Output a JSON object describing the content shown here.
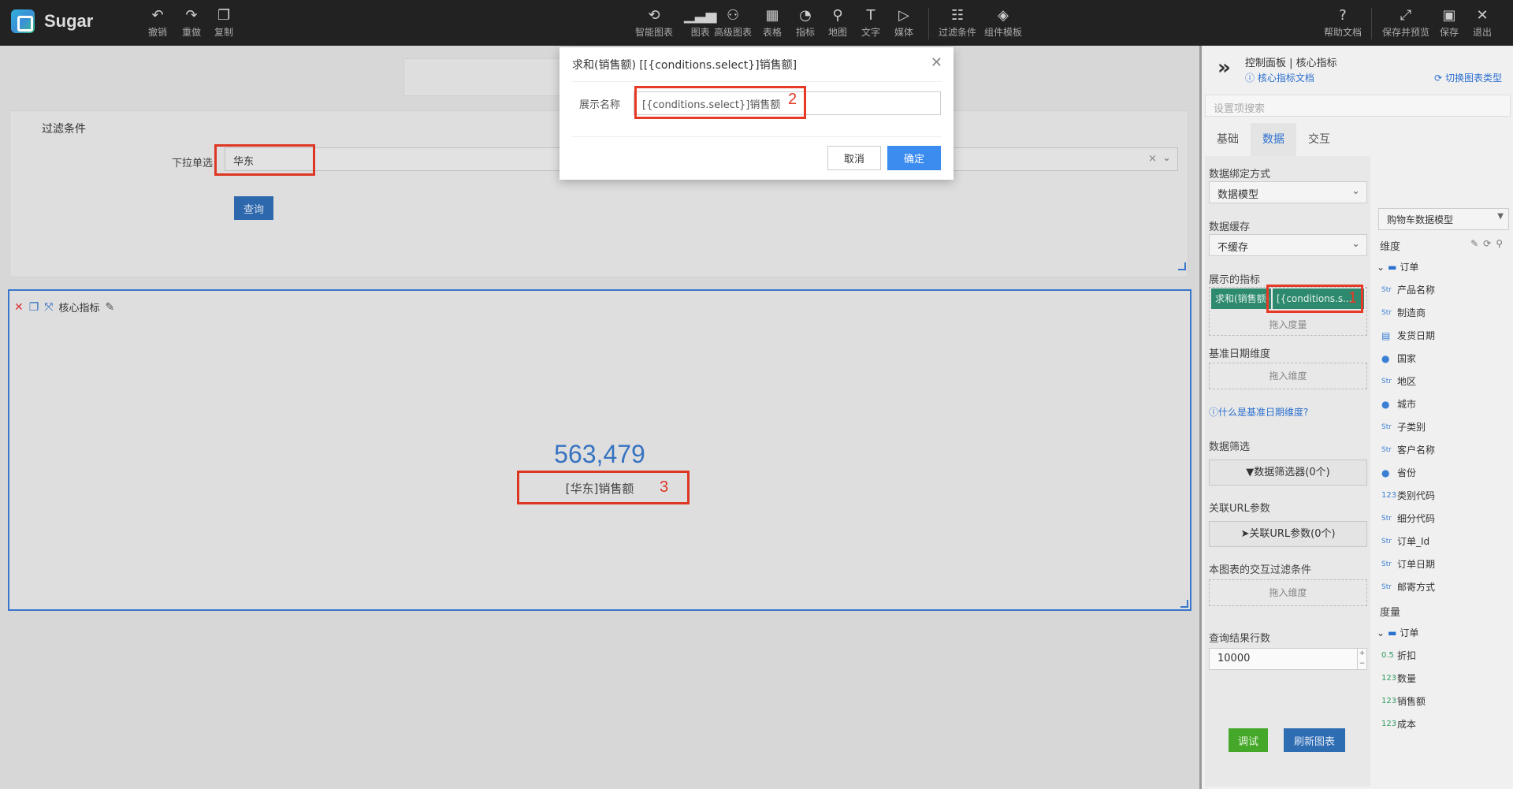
{
  "app": {
    "name": "Sugar"
  },
  "toolbar": {
    "left": [
      {
        "icon": "undo-icon",
        "label": "撤销"
      },
      {
        "icon": "redo-icon",
        "label": "重做"
      },
      {
        "icon": "copy-icon",
        "label": "复制"
      }
    ],
    "center": [
      {
        "icon": "smart-chart-icon",
        "label": "智能图表"
      },
      {
        "icon": "chart-icon",
        "label": "图表"
      },
      {
        "icon": "advanced-chart-icon",
        "label": "高级图表"
      },
      {
        "icon": "table-icon",
        "label": "表格"
      },
      {
        "icon": "gauge-icon",
        "label": "指标"
      },
      {
        "icon": "map-icon",
        "label": "地图"
      },
      {
        "icon": "text-icon",
        "label": "文字"
      },
      {
        "icon": "media-icon",
        "label": "媒体"
      },
      {
        "icon": "filter-condition-icon",
        "label": "过滤条件"
      },
      {
        "icon": "component-template-icon",
        "label": "组件模板"
      }
    ],
    "right": [
      {
        "icon": "help-icon",
        "label": "帮助文档"
      },
      {
        "icon": "save-preview-icon",
        "label": "保存并预览"
      },
      {
        "icon": "save-icon",
        "label": "保存"
      },
      {
        "icon": "exit-icon",
        "label": "退出"
      }
    ]
  },
  "filter": {
    "title": "过滤条件",
    "label": "下拉单选",
    "value": "华东",
    "query_label": "查询"
  },
  "chart": {
    "name": "核心指标",
    "value": "563,479",
    "label": "[华东]销售额"
  },
  "dialog": {
    "title": "求和(销售额) [[{conditions.select}]销售额]",
    "field_label": "展示名称",
    "field_value": "[{conditions.select}]销售额",
    "cancel": "取消",
    "ok": "确定"
  },
  "annotations": [
    "1",
    "2",
    "3"
  ],
  "panel": {
    "title": "控制面板 | 核心指标",
    "doc_link": "核心指标文档",
    "switch_type": "切换图表类型",
    "search_placeholder": "设置项搜索",
    "tabs": [
      "基础",
      "数据",
      "交互"
    ],
    "active_tab": "数据",
    "bind_mode_label": "数据绑定方式",
    "bind_mode_value": "数据模型",
    "cache_label": "数据缓存",
    "cache_value": "不缓存",
    "metrics_label": "展示的指标",
    "metric_chip_1": "求和(销售额)",
    "metric_chip_2": "[{conditions.s...",
    "drop_measure": "拖入度量",
    "base_date_label": "基准日期维度",
    "drop_dimension": "拖入维度",
    "base_date_help": "什么是基准日期维度?",
    "data_filter_label": "数据筛选",
    "data_filter_btn": "数据筛选器(0个)",
    "url_param_label": "关联URL参数",
    "url_param_btn": "关联URL参数(0个)",
    "interact_filter_label": "本图表的交互过滤条件",
    "drop_dimension_2": "拖入维度",
    "row_count_label": "查询结果行数",
    "row_count_value": "10000",
    "debug_btn": "调试",
    "refresh_btn": "刷新图表"
  },
  "model": {
    "selected": "购物车数据模型",
    "dimension_head": "维度",
    "dimension_folder": "订单",
    "dimensions": [
      {
        "type": "Str",
        "name": "产品名称"
      },
      {
        "type": "Str",
        "name": "制造商"
      },
      {
        "type": "date",
        "name": "发货日期"
      },
      {
        "type": "geo",
        "name": "国家"
      },
      {
        "type": "Str",
        "name": "地区"
      },
      {
        "type": "geo",
        "name": "城市"
      },
      {
        "type": "Str",
        "name": "子类别"
      },
      {
        "type": "Str",
        "name": "客户名称"
      },
      {
        "type": "geo",
        "name": "省份"
      },
      {
        "type": "123",
        "name": "类别代码"
      },
      {
        "type": "Str",
        "name": "细分代码"
      },
      {
        "type": "Str",
        "name": "订单_Id"
      },
      {
        "type": "Str",
        "name": "订单日期"
      },
      {
        "type": "Str",
        "name": "邮寄方式"
      }
    ],
    "measure_head": "度量",
    "measure_folder": "订单",
    "measures": [
      {
        "type": "0.5",
        "name": "折扣"
      },
      {
        "type": "123",
        "name": "数量"
      },
      {
        "type": "123",
        "name": "销售额"
      },
      {
        "type": "123",
        "name": "成本"
      }
    ]
  }
}
